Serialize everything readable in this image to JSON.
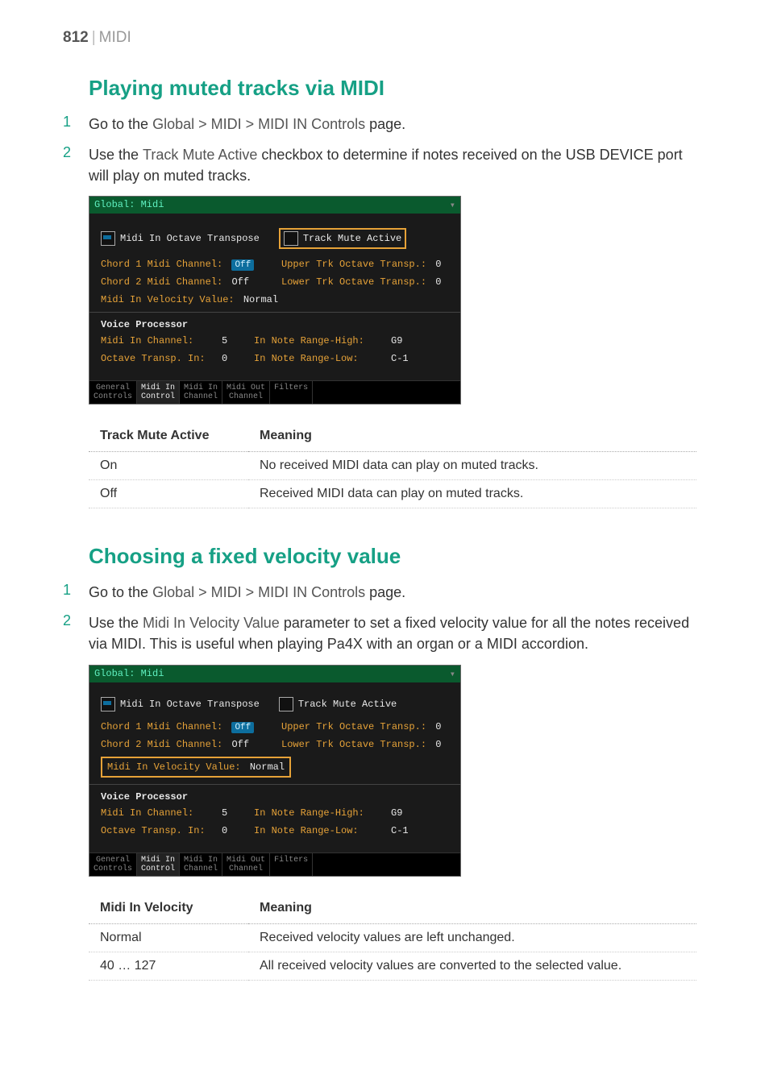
{
  "header": {
    "page_number": "812",
    "section": "MIDI"
  },
  "section1": {
    "title": "Playing muted tracks via MIDI",
    "step1_num": "1",
    "step1_pre": "Go to the ",
    "step1_path": "Global > MIDI > MIDI IN Controls",
    "step1_post": " page.",
    "step2_num": "2",
    "step2_pre": "Use the ",
    "step2_param": "Track Mute Active",
    "step2_post": " checkbox to determine if notes received on the USB DEVICE port will play on muted tracks."
  },
  "ui1": {
    "title": "Global: Midi",
    "cb1_label": "Midi In Octave Transpose",
    "cb2_label": "Track Mute Active",
    "chord1_label": "Chord 1 Midi Channel:",
    "chord1_value": "Off",
    "upper_label": "Upper Trk Octave Transp.:",
    "upper_value": "0",
    "chord2_label": "Chord 2 Midi Channel:",
    "chord2_value": "Off",
    "lower_label": "Lower Trk Octave Transp.:",
    "lower_value": "0",
    "vel_label": "Midi In Velocity Value:",
    "vel_value": "Normal",
    "vp_header": "Voice Processor",
    "vp_ch_label": "Midi In Channel:",
    "vp_ch_value": "5",
    "vp_oct_label": "Octave Transp. In:",
    "vp_oct_value": "0",
    "vp_high_label": "In Note Range-High:",
    "vp_high_value": "G9",
    "vp_low_label": "In Note Range-Low:",
    "vp_low_value": "C-1",
    "tabs": {
      "t1a": "General",
      "t1b": "Controls",
      "t2a": "Midi In",
      "t2b": "Control",
      "t3a": "Midi In",
      "t3b": "Channel",
      "t4a": "Midi Out",
      "t4b": "Channel",
      "t5": "Filters"
    }
  },
  "table1": {
    "h1": "Track Mute Active",
    "h2": "Meaning",
    "r1c1": "On",
    "r1c2": "No received MIDI data can play on muted tracks.",
    "r2c1": "Off",
    "r2c2": "Received MIDI data can play on muted tracks."
  },
  "section2": {
    "title": "Choosing a fixed velocity value",
    "step1_num": "1",
    "step1_pre": "Go to the ",
    "step1_path": "Global > MIDI > MIDI IN Controls",
    "step1_post": " page.",
    "step2_num": "2",
    "step2_pre": "Use the ",
    "step2_param": "Midi In Velocity Value",
    "step2_post": " parameter to set a fixed velocity value for all the notes received via MIDI. This is useful when playing Pa4X with an organ or a MIDI accordion."
  },
  "table2": {
    "h1": "Midi In Velocity",
    "h2": "Meaning",
    "r1c1": "Normal",
    "r1c2": "Received velocity values are left unchanged.",
    "r2c1": "40 … 127",
    "r2c2": "All received velocity values are converted to the selected value."
  }
}
